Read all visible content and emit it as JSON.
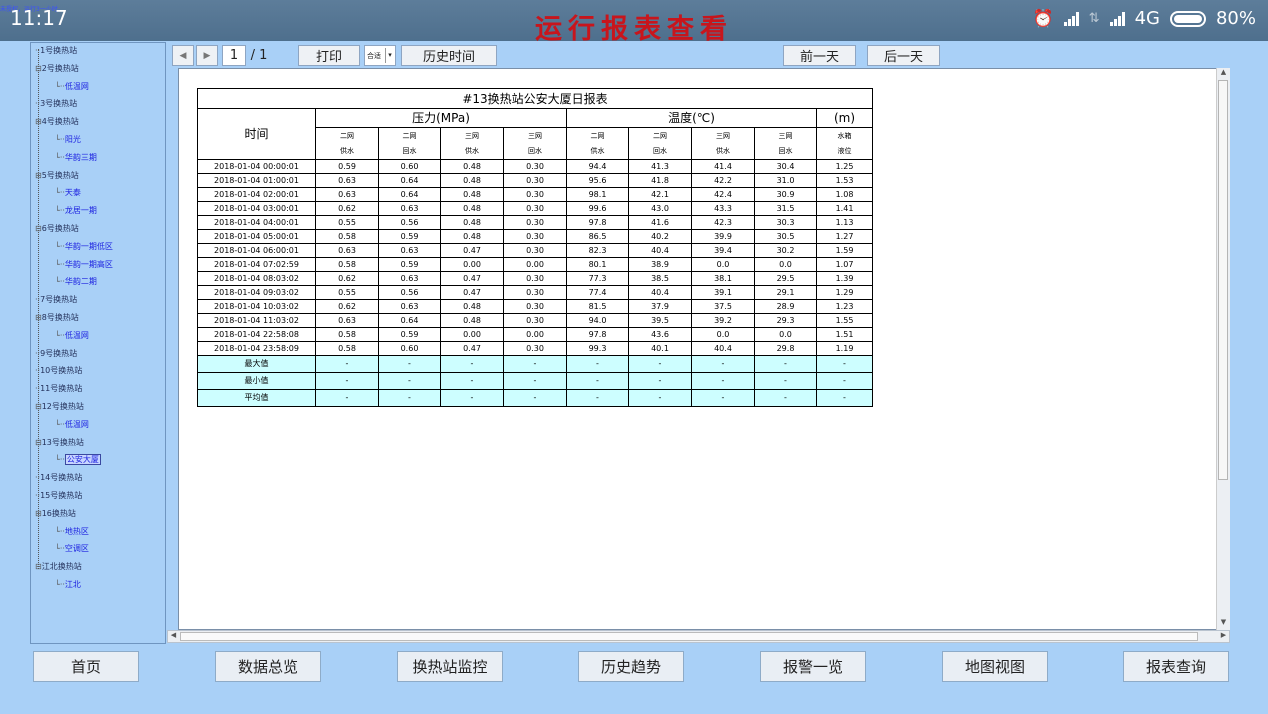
{
  "status_bar": {
    "time": "11:17",
    "note": "未授权，运行3一小时。",
    "network": "4G",
    "battery": "80%"
  },
  "app_title": "运行报表查看",
  "tree": [
    {
      "label": "1号换热站",
      "level": 0
    },
    {
      "label": "2号换热站",
      "level": 0,
      "expanded": true
    },
    {
      "label": "低温网",
      "level": 1
    },
    {
      "label": "3号换热站",
      "level": 0
    },
    {
      "label": "4号换热站",
      "level": 0,
      "expanded": true
    },
    {
      "label": "阳光",
      "level": 1
    },
    {
      "label": "华韵三期",
      "level": 1
    },
    {
      "label": "5号换热站",
      "level": 0,
      "expanded": true
    },
    {
      "label": "天泰",
      "level": 1
    },
    {
      "label": "龙居一期",
      "level": 1
    },
    {
      "label": "6号换热站",
      "level": 0,
      "expanded": true
    },
    {
      "label": "华韵一期低区",
      "level": 1
    },
    {
      "label": "华韵一期高区",
      "level": 1
    },
    {
      "label": "华韵二期",
      "level": 1
    },
    {
      "label": "7号换热站",
      "level": 0
    },
    {
      "label": "8号换热站",
      "level": 0,
      "expanded": true
    },
    {
      "label": "低温网",
      "level": 1
    },
    {
      "label": "9号换热站",
      "level": 0
    },
    {
      "label": "10号换热站",
      "level": 0
    },
    {
      "label": "11号换热站",
      "level": 0
    },
    {
      "label": "12号换热站",
      "level": 0,
      "expanded": true
    },
    {
      "label": "低温网",
      "level": 1
    },
    {
      "label": "13号换热站",
      "level": 0,
      "expanded": true
    },
    {
      "label": "公安大厦",
      "level": 1,
      "selected": true
    },
    {
      "label": "14号换热站",
      "level": 0
    },
    {
      "label": "15号换热站",
      "level": 0
    },
    {
      "label": "16换热站",
      "level": 0,
      "expanded": true
    },
    {
      "label": "地热区",
      "level": 1
    },
    {
      "label": "空调区",
      "level": 1
    },
    {
      "label": "江北换热站",
      "level": 0,
      "expanded": true
    },
    {
      "label": "江北",
      "level": 1
    }
  ],
  "toolbar": {
    "page_current": "1",
    "page_total": "/ 1",
    "print_label": "打印",
    "zoom_value": "合适",
    "history_time_label": "历史时间",
    "prev_day_label": "前一天",
    "next_day_label": "后一天"
  },
  "report": {
    "title": "#13换热站公安大厦日报表",
    "time_header": "时间",
    "group_pressure": "压力(MPa)",
    "group_temperature": "温度(℃)",
    "group_level": "(m)",
    "subheaders_top": [
      "二网",
      "二网",
      "三网",
      "三网",
      "二网",
      "二网",
      "三网",
      "三网",
      "水箱"
    ],
    "subheaders_bottom": [
      "供水",
      "回水",
      "供水",
      "回水",
      "供水",
      "回水",
      "供水",
      "回水",
      "液位"
    ],
    "rows": [
      [
        "2018-01-04 00:00:01",
        "0.59",
        "0.60",
        "0.48",
        "0.30",
        "94.4",
        "41.3",
        "41.4",
        "30.4",
        "1.25"
      ],
      [
        "2018-01-04 01:00:01",
        "0.63",
        "0.64",
        "0.48",
        "0.30",
        "95.6",
        "41.8",
        "42.2",
        "31.0",
        "1.53"
      ],
      [
        "2018-01-04 02:00:01",
        "0.63",
        "0.64",
        "0.48",
        "0.30",
        "98.1",
        "42.1",
        "42.4",
        "30.9",
        "1.08"
      ],
      [
        "2018-01-04 03:00:01",
        "0.62",
        "0.63",
        "0.48",
        "0.30",
        "99.6",
        "43.0",
        "43.3",
        "31.5",
        "1.41"
      ],
      [
        "2018-01-04 04:00:01",
        "0.55",
        "0.56",
        "0.48",
        "0.30",
        "97.8",
        "41.6",
        "42.3",
        "30.3",
        "1.13"
      ],
      [
        "2018-01-04 05:00:01",
        "0.58",
        "0.59",
        "0.48",
        "0.30",
        "86.5",
        "40.2",
        "39.9",
        "30.5",
        "1.27"
      ],
      [
        "2018-01-04 06:00:01",
        "0.63",
        "0.63",
        "0.47",
        "0.30",
        "82.3",
        "40.4",
        "39.4",
        "30.2",
        "1.59"
      ],
      [
        "2018-01-04 07:02:59",
        "0.58",
        "0.59",
        "0.00",
        "0.00",
        "80.1",
        "38.9",
        "0.0",
        "0.0",
        "1.07"
      ],
      [
        "2018-01-04 08:03:02",
        "0.62",
        "0.63",
        "0.47",
        "0.30",
        "77.3",
        "38.5",
        "38.1",
        "29.5",
        "1.39"
      ],
      [
        "2018-01-04 09:03:02",
        "0.55",
        "0.56",
        "0.47",
        "0.30",
        "77.4",
        "40.4",
        "39.1",
        "29.1",
        "1.29"
      ],
      [
        "2018-01-04 10:03:02",
        "0.62",
        "0.63",
        "0.48",
        "0.30",
        "81.5",
        "37.9",
        "37.5",
        "28.9",
        "1.23"
      ],
      [
        "2018-01-04 11:03:02",
        "0.63",
        "0.64",
        "0.48",
        "0.30",
        "94.0",
        "39.5",
        "39.2",
        "29.3",
        "1.55"
      ],
      [
        "2018-01-04 22:58:08",
        "0.58",
        "0.59",
        "0.00",
        "0.00",
        "97.8",
        "43.6",
        "0.0",
        "0.0",
        "1.51"
      ],
      [
        "2018-01-04 23:58:09",
        "0.58",
        "0.60",
        "0.47",
        "0.30",
        "99.3",
        "40.1",
        "40.4",
        "29.8",
        "1.19"
      ]
    ],
    "summary_rows": [
      [
        "最大值",
        "-",
        "-",
        "-",
        "-",
        "-",
        "-",
        "-",
        "-",
        "-"
      ],
      [
        "最小值",
        "-",
        "-",
        "-",
        "-",
        "-",
        "-",
        "-",
        "-",
        "-"
      ],
      [
        "平均值",
        "-",
        "-",
        "-",
        "-",
        "-",
        "-",
        "-",
        "-",
        "-"
      ]
    ]
  },
  "bottom_nav": [
    "首页",
    "数据总览",
    "换热站监控",
    "历史趋势",
    "报警一览",
    "地图视图",
    "报表查询"
  ],
  "colors": {
    "background": "#a9d0f7",
    "title_red": "#c8151c",
    "summary_fill": "#cdfeff",
    "tree_child_blue": "#1b1fe0"
  }
}
